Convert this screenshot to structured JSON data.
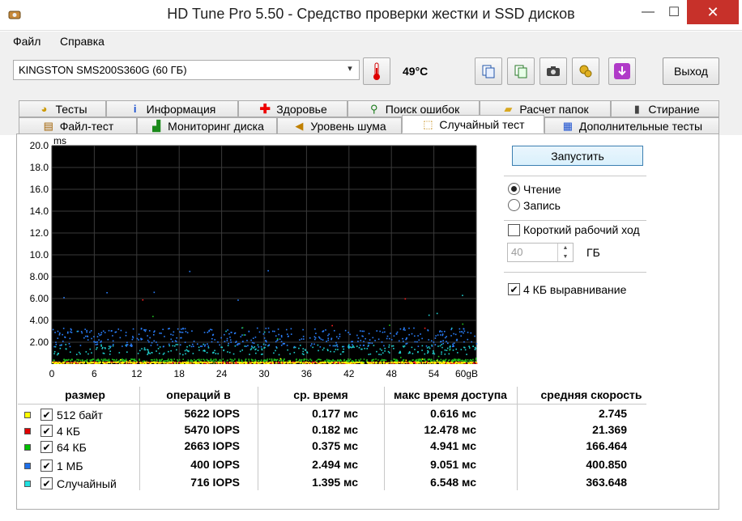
{
  "window": {
    "title": "HD Tune Pro 5.50 - Средство проверки жестки и SSD дисков",
    "minimize": "—",
    "maximize": "☐",
    "close": "✕"
  },
  "menu": {
    "file": "Файл",
    "help": "Справка"
  },
  "toolbar": {
    "drive": "KINGSTON SMS200S360G (60 ГБ)",
    "temperature": "49°C",
    "exit_label": "Выход",
    "icons": [
      "thermometer-icon",
      "copy-icon",
      "copy-all-icon",
      "camera-icon",
      "options-icon",
      "save-icon"
    ]
  },
  "tabs": {
    "row1": [
      {
        "label": "Тесты",
        "icon": "benchmark-icon"
      },
      {
        "label": "Информация",
        "icon": "info-icon"
      },
      {
        "label": "Здоровье",
        "icon": "health-icon"
      },
      {
        "label": "Поиск ошибок",
        "icon": "error-scan-icon"
      },
      {
        "label": "Расчет папок",
        "icon": "folder-usage-icon"
      },
      {
        "label": "Стирание",
        "icon": "erase-icon"
      }
    ],
    "row2": [
      {
        "label": "Файл-тест",
        "icon": "file-test-icon"
      },
      {
        "label": "Мониторинг диска",
        "icon": "disk-monitor-icon"
      },
      {
        "label": "Уровень шума",
        "icon": "noise-icon"
      },
      {
        "label": "Случайный тест",
        "icon": "random-access-icon",
        "active": true
      },
      {
        "label": "Дополнительные тесты",
        "icon": "extra-tests-icon"
      }
    ]
  },
  "controls": {
    "start": "Запустить",
    "read": "Чтение",
    "write": "Запись",
    "mode": "read",
    "short_stroke": "Короткий рабочий ход",
    "short_stroke_checked": false,
    "gb_value": "40",
    "gb_unit": "ГБ",
    "align_4k": "4 КБ выравнивание",
    "align_4k_checked": true
  },
  "chart_data": {
    "type": "scatter",
    "ylabel": "ms",
    "xlabel": "",
    "x_unit": "gB",
    "ylim": [
      0,
      20
    ],
    "xlim": [
      0,
      60
    ],
    "y_ticks": [
      "20.0",
      "18.0",
      "16.0",
      "14.0",
      "12.0",
      "10.0",
      "8.00",
      "6.00",
      "4.00",
      "2.00"
    ],
    "x_ticks": [
      "0",
      "6",
      "12",
      "18",
      "24",
      "30",
      "36",
      "42",
      "48",
      "54",
      "60gB"
    ],
    "grid": true,
    "series": [
      {
        "name": "512 байт",
        "color": "#ffff00",
        "avg_ms": 0.177,
        "max_ms": 0.616
      },
      {
        "name": "4 КБ",
        "color": "#ff2020",
        "avg_ms": 0.182,
        "max_ms": 12.478
      },
      {
        "name": "64 КБ",
        "color": "#20c020",
        "avg_ms": 0.375,
        "max_ms": 4.941
      },
      {
        "name": "1 МБ",
        "color": "#2a80ff",
        "avg_ms": 2.494,
        "max_ms": 9.051
      },
      {
        "name": "Случайный",
        "color": "#20d0d0",
        "avg_ms": 1.395,
        "max_ms": 6.548
      }
    ]
  },
  "table": {
    "headers": [
      "размер",
      "операций в",
      "ср. время",
      "макс время доступа",
      "средняя скорость"
    ],
    "rows": [
      {
        "label": "512 байт",
        "color": "#ffff00",
        "checked": true,
        "iops": "5622 IOPS",
        "avg": "0.177 мс",
        "max": "0.616 мс",
        "speed": "2.745"
      },
      {
        "label": "4 КБ",
        "color": "#e00000",
        "checked": true,
        "iops": "5470 IOPS",
        "avg": "0.182 мс",
        "max": "12.478 мс",
        "speed": "21.369"
      },
      {
        "label": "64 КБ",
        "color": "#00c000",
        "checked": true,
        "iops": "2663 IOPS",
        "avg": "0.375 мс",
        "max": "4.941 мс",
        "speed": "166.464"
      },
      {
        "label": "1 МБ",
        "color": "#1e6fe8",
        "checked": true,
        "iops": "400 IOPS",
        "avg": "2.494 мс",
        "max": "9.051 мс",
        "speed": "400.850"
      },
      {
        "label": "Случайный",
        "color": "#20e0e0",
        "checked": true,
        "iops": "716 IOPS",
        "avg": "1.395 мс",
        "max": "6.548 мс",
        "speed": "363.648"
      }
    ]
  }
}
